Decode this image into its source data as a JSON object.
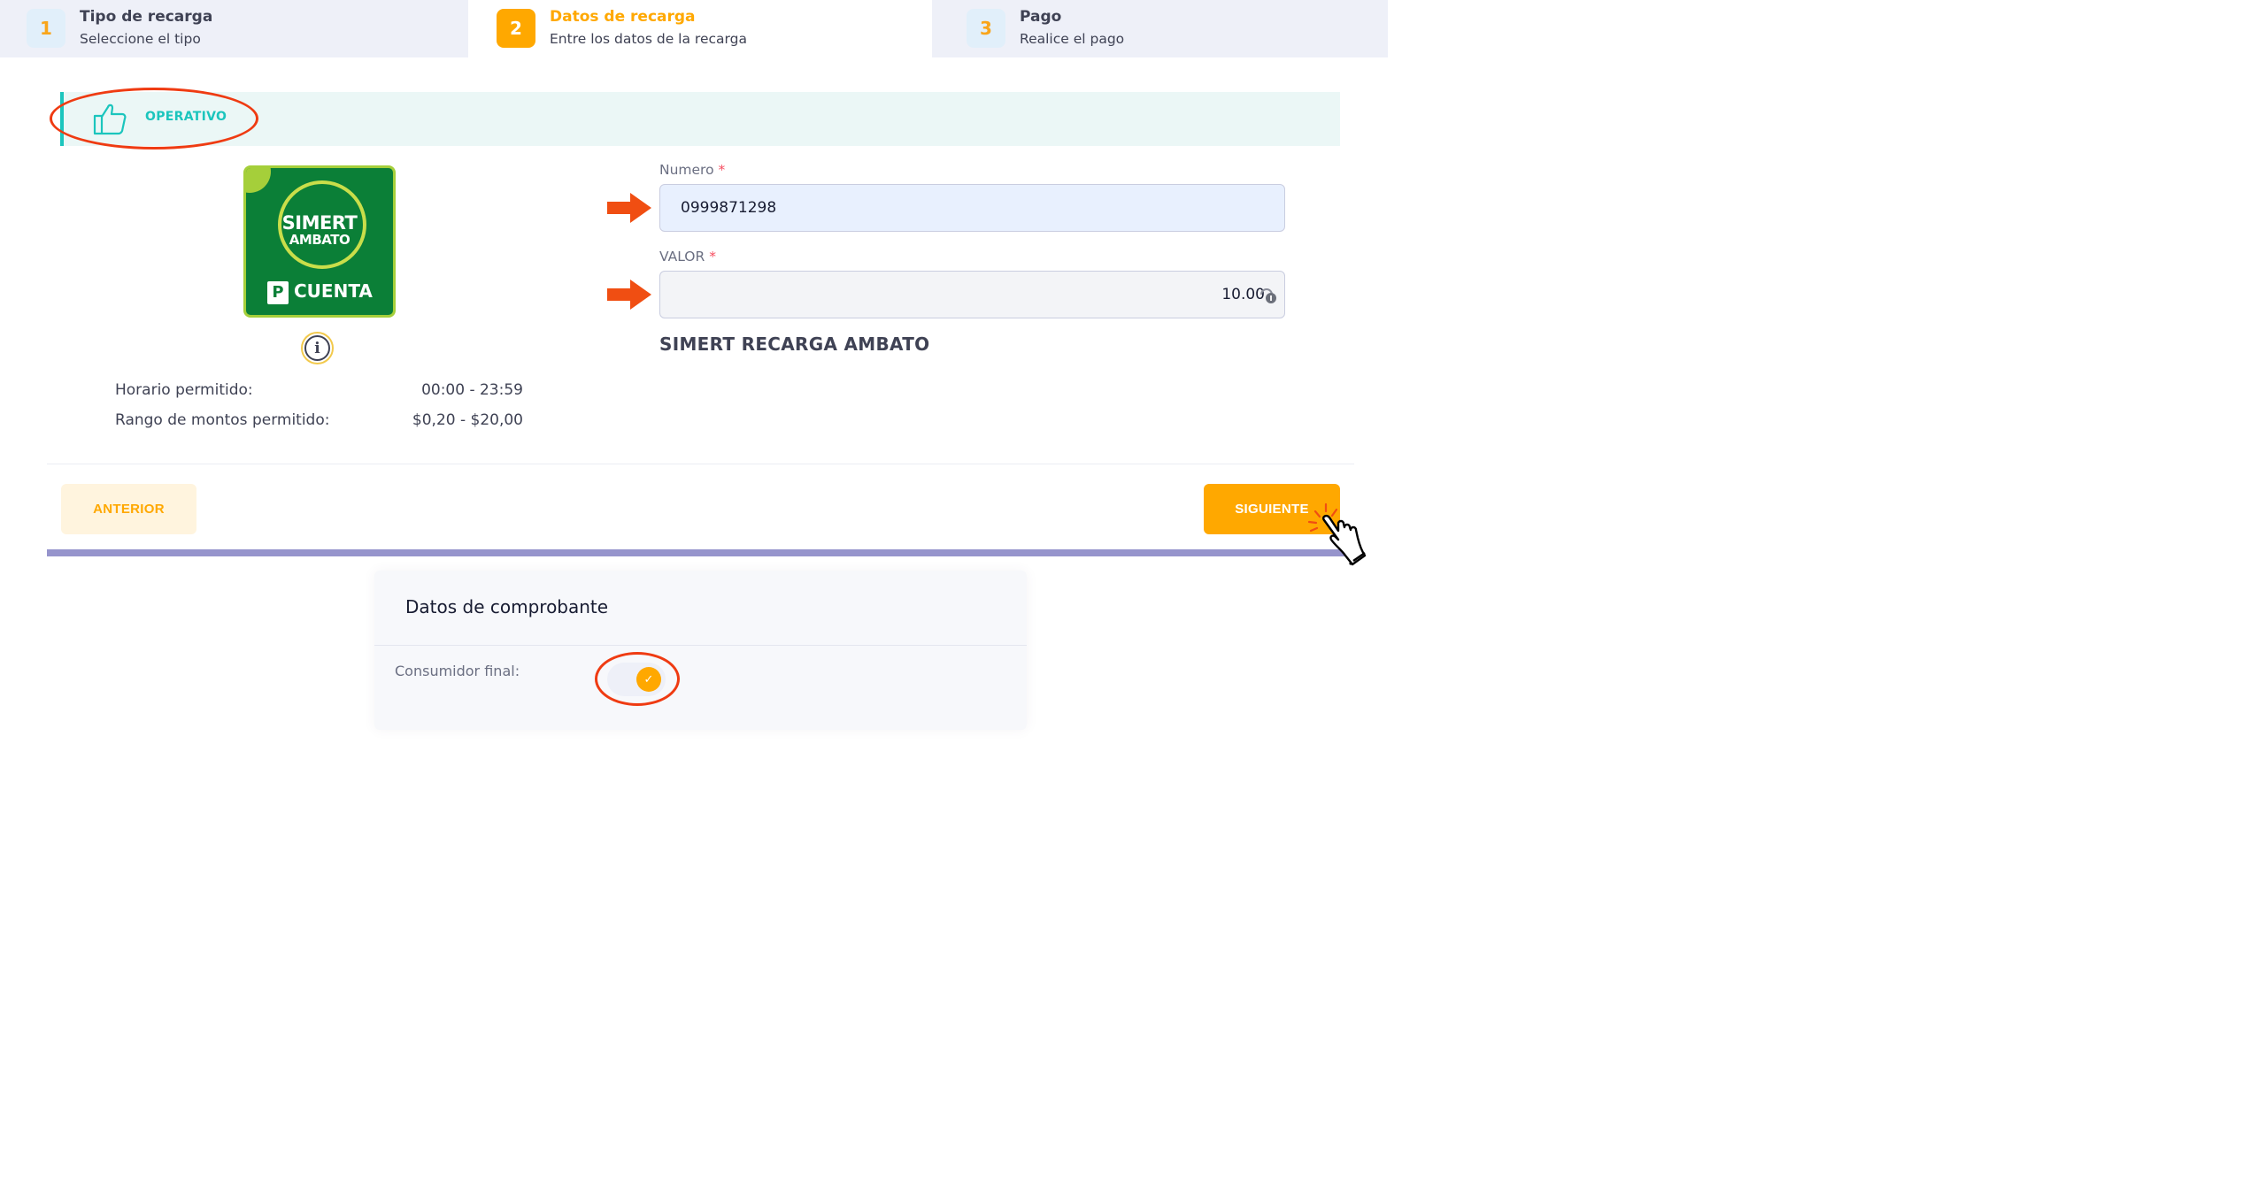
{
  "stepper": {
    "steps": [
      {
        "number": "1",
        "title": "Tipo de recarga",
        "subtitle": "Seleccione el tipo",
        "state": "inactive"
      },
      {
        "number": "2",
        "title": "Datos de recarga",
        "subtitle": "Entre los datos de la recarga",
        "state": "active"
      },
      {
        "number": "3",
        "title": "Pago",
        "subtitle": "Realice el pago",
        "state": "inactive"
      }
    ]
  },
  "status": {
    "label": "OPERATIVO",
    "icon": "thumbs-up-icon",
    "color": "#1bc5bd"
  },
  "product": {
    "logo_line1": "SIMERT",
    "logo_line2": "AMBATO",
    "logo_p": "P",
    "logo_cuenta": "CUENTA",
    "name": "SIMERT RECARGA AMBATO",
    "info_icon": "info-icon"
  },
  "details": {
    "horario_label": "Horario permitido:",
    "horario_value": "00:00 - 23:59",
    "rango_label": "Rango de montos permitido:",
    "rango_value": "$0,20 - $20,00"
  },
  "form": {
    "numero_label": "Numero",
    "numero_value": "0999871298",
    "valor_label": "VALOR",
    "valor_value": "10.00",
    "required_mark": "*"
  },
  "actions": {
    "prev_label": "ANTERIOR",
    "next_label": "SIGUIENTE"
  },
  "receipt": {
    "title": "Datos de comprobante",
    "consumidor_label": "Consumidor final:",
    "consumidor_checked": true
  },
  "colors": {
    "accent": "#ffa800",
    "annotation": "#ef3b12",
    "progress": "#9694cc"
  }
}
